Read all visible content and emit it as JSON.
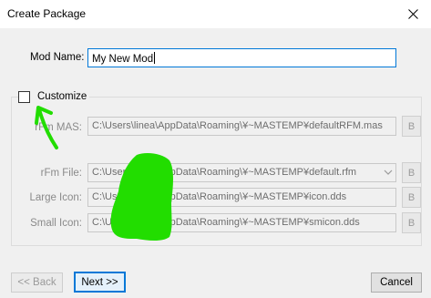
{
  "window": {
    "title": "Create Package"
  },
  "mod_name": {
    "label": "Mod Name:",
    "value": "My New Mod"
  },
  "customize": {
    "label": "Customize",
    "checked": false
  },
  "fields": [
    {
      "label": "rFm MAS:",
      "value": "C:\\Users\\linea\\AppData\\Roaming\\¥~MASTEMP¥defaultRFM.mas",
      "button": "B"
    },
    {
      "label": "rFm File:",
      "value": "C:\\Users\\linea\\AppData\\Roaming\\¥~MASTEMP¥default.rfm",
      "button": "B"
    },
    {
      "label": "Large Icon:",
      "value": "C:\\Users\\linea\\AppData\\Roaming\\¥~MASTEMP¥icon.dds",
      "button": "B"
    },
    {
      "label": "Small Icon:",
      "value": "C:\\Users\\linea\\AppData\\Roaming\\¥~MASTEMP¥smicon.dds",
      "button": "B"
    }
  ],
  "buttons": {
    "back": "<< Back",
    "next": "Next >>",
    "cancel": "Cancel"
  },
  "colors": {
    "annotation_green": "#22dd00",
    "accent": "#0078d7"
  }
}
